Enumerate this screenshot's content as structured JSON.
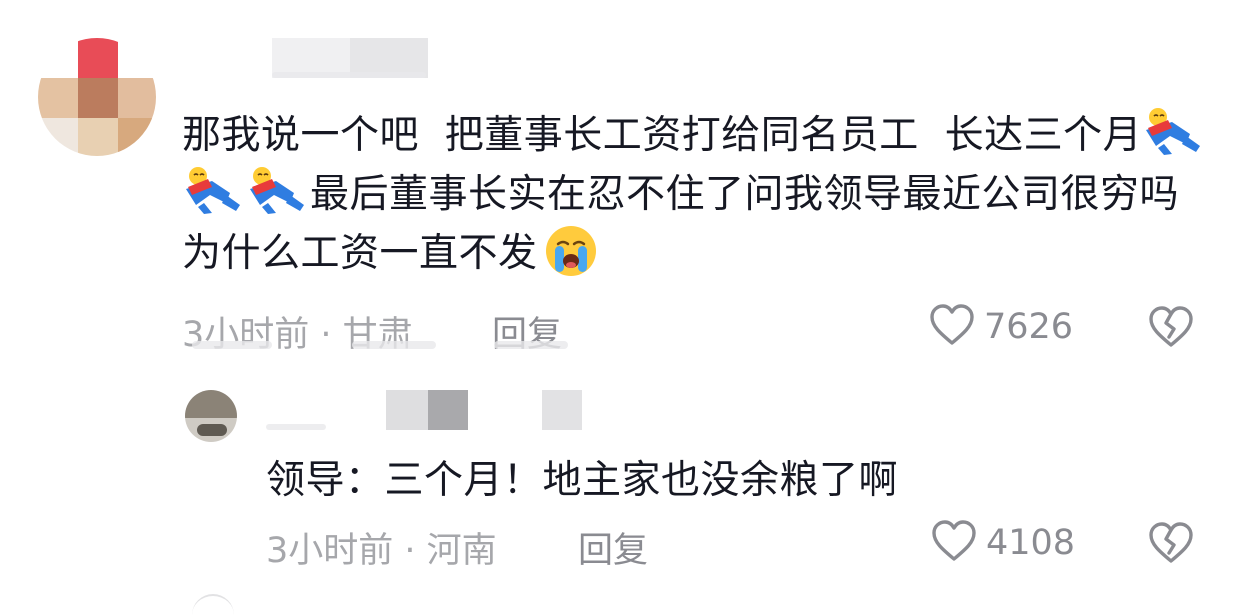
{
  "comment": {
    "avatar_icon": "user-avatar-icon",
    "text_before_emojis": "那我说一个吧  把董事长工资打给同名员工  长达三个月",
    "text_after_emojis": "最后董事长实在忍不住了问我领导最近公司很穷吗 为什么工资一直不发",
    "inline_emoji_icons": [
      "falling-over-emoji-icon",
      "falling-over-emoji-icon",
      "falling-over-emoji-icon"
    ],
    "trailing_emoji_icon": "crying-face-emoji-icon",
    "time_location": "3小时前 · 甘肃",
    "reply_label": "回复",
    "like_icon": "heart-outline-icon",
    "like_count": "7626",
    "dislike_icon": "broken-heart-icon"
  },
  "reply": {
    "avatar_icon": "user-avatar-icon",
    "text": "领导：三个月！地主家也没余粮了啊",
    "time_location": "3小时前 · 河南",
    "reply_label": "回复",
    "like_icon": "heart-outline-icon",
    "like_count": "4108",
    "dislike_icon": "broken-heart-icon"
  },
  "colors": {
    "text_primary": "#161823",
    "text_meta": "#a6a7ab",
    "action": "#8a8b91",
    "background": "#ffffff"
  }
}
